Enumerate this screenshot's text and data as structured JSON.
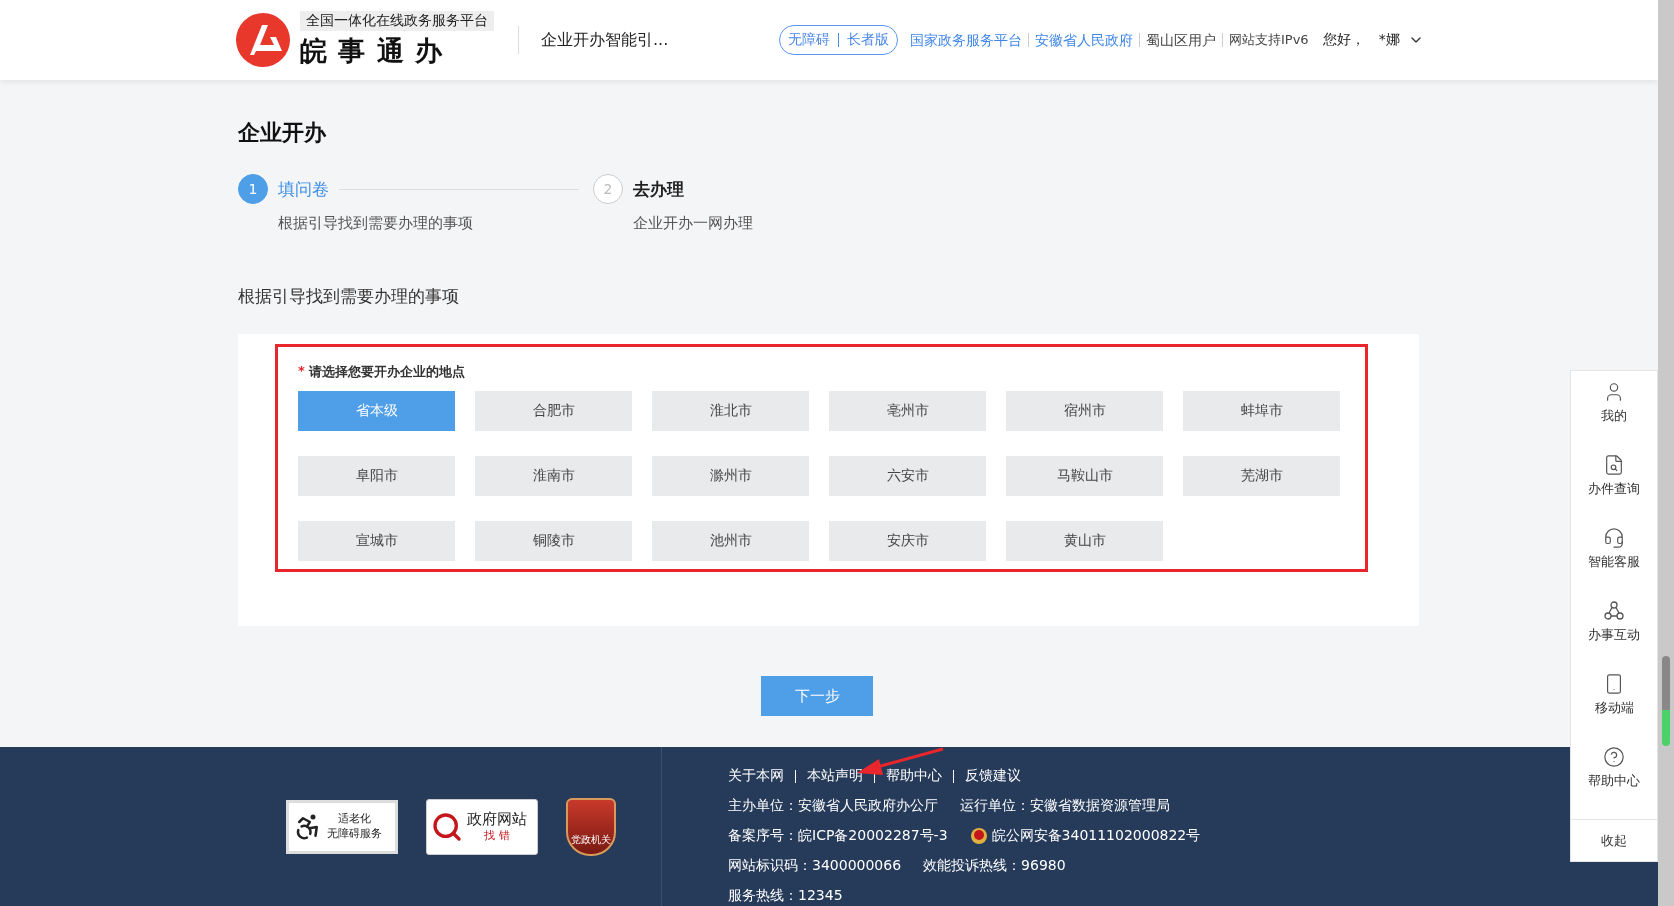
{
  "header": {
    "platform_tag": "全国一体化在线政务服务平台",
    "brand": "皖 事 通 办",
    "page_title": "企业开办智能引...",
    "access_modes": [
      "无障碍",
      "长者版"
    ],
    "links": [
      {
        "label": "国家政务服务平台",
        "kind": "link"
      },
      {
        "label": "安徽省人民政府",
        "kind": "link"
      },
      {
        "label": "蜀山区用户",
        "kind": "plain"
      },
      {
        "label": "网站支持IPv6",
        "kind": "small"
      }
    ],
    "greeting": "您好，",
    "user": "*娜"
  },
  "page_title": "企业开办",
  "steps": [
    {
      "number": "1",
      "title": "填问卷",
      "description": "根据引导找到需要办理的事项",
      "selected": true
    },
    {
      "number": "2",
      "title": "去办理",
      "description": "企业开办一网办理",
      "selected": false
    }
  ],
  "section_title": "根据引导找到需要办理的事项",
  "location": {
    "required_mark": "*",
    "label": "请选择您要开办企业的地点",
    "options": [
      {
        "label": "省本级",
        "selected": true
      },
      {
        "label": "合肥市",
        "selected": false
      },
      {
        "label": "淮北市",
        "selected": false
      },
      {
        "label": "亳州市",
        "selected": false
      },
      {
        "label": "宿州市",
        "selected": false
      },
      {
        "label": "蚌埠市",
        "selected": false
      },
      {
        "label": "阜阳市",
        "selected": false
      },
      {
        "label": "淮南市",
        "selected": false
      },
      {
        "label": "滁州市",
        "selected": false
      },
      {
        "label": "六安市",
        "selected": false
      },
      {
        "label": "马鞍山市",
        "selected": false
      },
      {
        "label": "芜湖市",
        "selected": false
      },
      {
        "label": "宣城市",
        "selected": false
      },
      {
        "label": "铜陵市",
        "selected": false
      },
      {
        "label": "池州市",
        "selected": false
      },
      {
        "label": "安庆市",
        "selected": false
      },
      {
        "label": "黄山市",
        "selected": false
      }
    ]
  },
  "next_button": "下一步",
  "side_panel": {
    "items": [
      {
        "label": "我的",
        "kind": "user"
      },
      {
        "label": "办件查询",
        "kind": "search"
      },
      {
        "label": "智能客服",
        "kind": "service"
      },
      {
        "label": "办事互动",
        "kind": "interact"
      },
      {
        "label": "移动端",
        "kind": "mobile"
      },
      {
        "label": "帮助中心",
        "kind": "help"
      }
    ],
    "collapse": "收起"
  },
  "footer": {
    "badges": [
      {
        "kind": "elderly",
        "lines": [
          "适老化",
          "无障碍服务"
        ]
      },
      {
        "kind": "error",
        "lines": [
          "政府网站",
          "找 错"
        ]
      },
      {
        "kind": "party",
        "lines": [
          "党政机关"
        ]
      }
    ],
    "links": [
      "关于本网",
      "本站声明",
      "帮助中心",
      "反馈建议"
    ],
    "info_rows": [
      [
        {
          "text": "主办单位：安徽省人民政府办公厅",
          "emblem": false
        },
        {
          "text": "运行单位：安徽省数据资源管理局",
          "emblem": false
        }
      ],
      [
        {
          "text": "备案序号：皖ICP备20002287号-3",
          "emblem": false
        },
        {
          "text": "皖公网安备34011102000822号",
          "emblem": true
        }
      ],
      [
        {
          "text": "网站标识码：3400000066",
          "emblem": false
        },
        {
          "text": "效能投诉热线：96980",
          "emblem": false
        }
      ],
      [
        {
          "text": "服务热线：12345",
          "emblem": false
        }
      ]
    ]
  }
}
